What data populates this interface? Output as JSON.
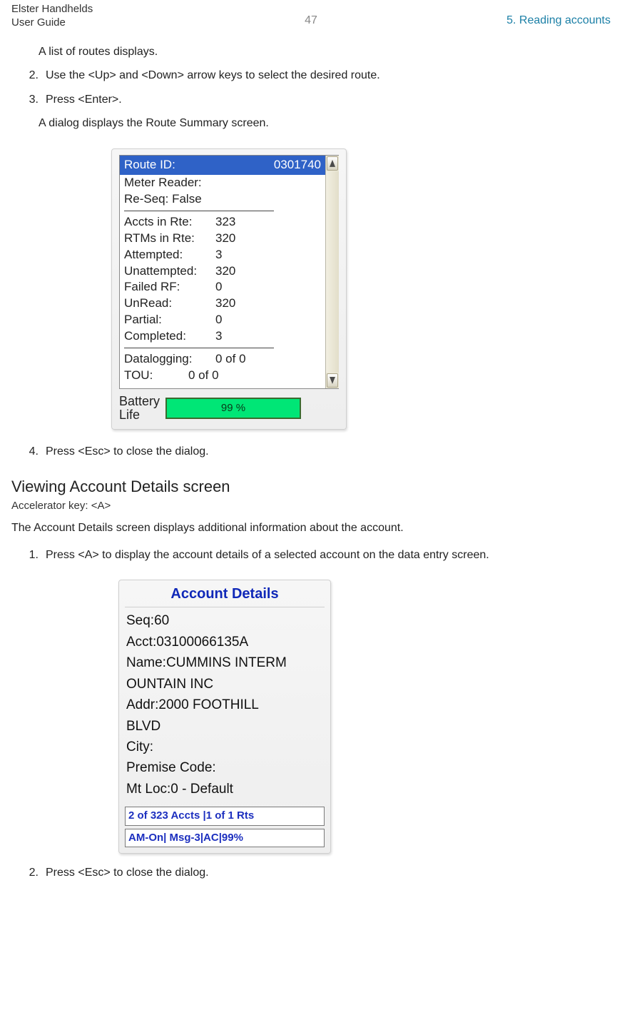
{
  "header": {
    "brand1": "Elster Handhelds",
    "brand2": "User Guide",
    "page_number": "47",
    "chapter": "5. Reading accounts"
  },
  "body": {
    "pre_para": "A list of routes displays.",
    "steps_top": [
      {
        "num": "2.",
        "text": "Use the <Up> and <Down> arrow keys to select the desired route."
      },
      {
        "num": "3.",
        "text": "Press <Enter>."
      }
    ],
    "post_para": "A dialog displays the Route Summary screen.",
    "step4": {
      "num": "4.",
      "text": "Press <Esc> to close the dialog."
    },
    "section_heading": "Viewing Account Details screen",
    "accel": "Accelerator key: <A>",
    "sec_desc": "The Account Details screen displays additional information about the account.",
    "steps_mid": [
      {
        "num": "1.",
        "text": "Press <A> to display the account details of a selected account on the data entry screen."
      }
    ],
    "step_last": {
      "num": "2.",
      "text": "Press <Esc> to close the dialog."
    }
  },
  "route_summary": {
    "selected_label": "Route ID:",
    "selected_value": "0301740",
    "rows": [
      {
        "label": "Meter Reader:",
        "value": ""
      },
      {
        "label": "Re-Seq: False",
        "value": ""
      }
    ],
    "rows2": [
      {
        "label": "Accts in Rte:",
        "value": "323"
      },
      {
        "label": "RTMs in Rte:",
        "value": "320"
      },
      {
        "label": "Attempted:",
        "value": "3"
      },
      {
        "label": "Unattempted:",
        "value": "320"
      },
      {
        "label": "Failed RF:",
        "value": "0"
      },
      {
        "label": "UnRead:",
        "value": "320"
      },
      {
        "label": "Partial:",
        "value": "0"
      },
      {
        "label": "Completed:",
        "value": "3"
      }
    ],
    "rows3": [
      {
        "label": "Datalogging:",
        "value": "0 of 0"
      },
      {
        "label": "TOU:",
        "value": "0 of 0"
      }
    ],
    "battery_label": "Battery\nLife",
    "battery_value": "99 %"
  },
  "account_details": {
    "title": "Account Details",
    "lines": [
      "Seq:60",
      "Acct:03100066135A",
      "Name:CUMMINS INTERM",
      "OUNTAIN INC",
      "Addr:2000 FOOTHILL",
      "BLVD",
      "City:",
      "Premise Code:",
      "Mt Loc:0 - Default"
    ],
    "status1": "2 of 323 Accts |1 of 1 Rts",
    "status2": "AM-On| Msg-3|AC|99%"
  }
}
